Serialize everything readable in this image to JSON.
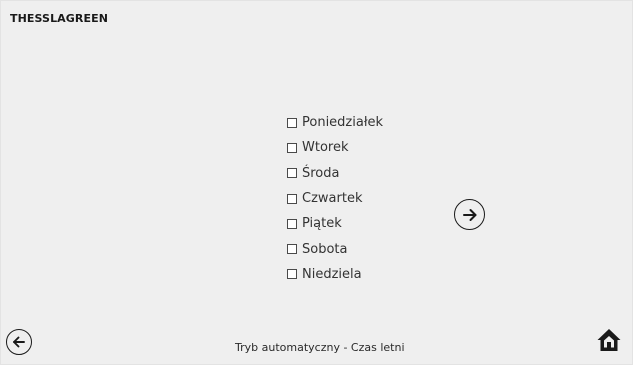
{
  "header": {
    "brand": "THESSLAGREEN"
  },
  "days": [
    {
      "label": "Poniedziałek",
      "checked": false
    },
    {
      "label": "Wtorek",
      "checked": false
    },
    {
      "label": "Środa",
      "checked": false
    },
    {
      "label": "Czwartek",
      "checked": false
    },
    {
      "label": "Piątek",
      "checked": false
    },
    {
      "label": "Sobota",
      "checked": false
    },
    {
      "label": "Niedziela",
      "checked": false
    }
  ],
  "footer": {
    "status": "Tryb automatyczny - Czas letni"
  },
  "icons": {
    "back": "arrow-left-icon",
    "next": "arrow-right-icon",
    "home": "home-icon"
  },
  "colors": {
    "background": "#efefef",
    "foreground": "#1a1a1a"
  }
}
